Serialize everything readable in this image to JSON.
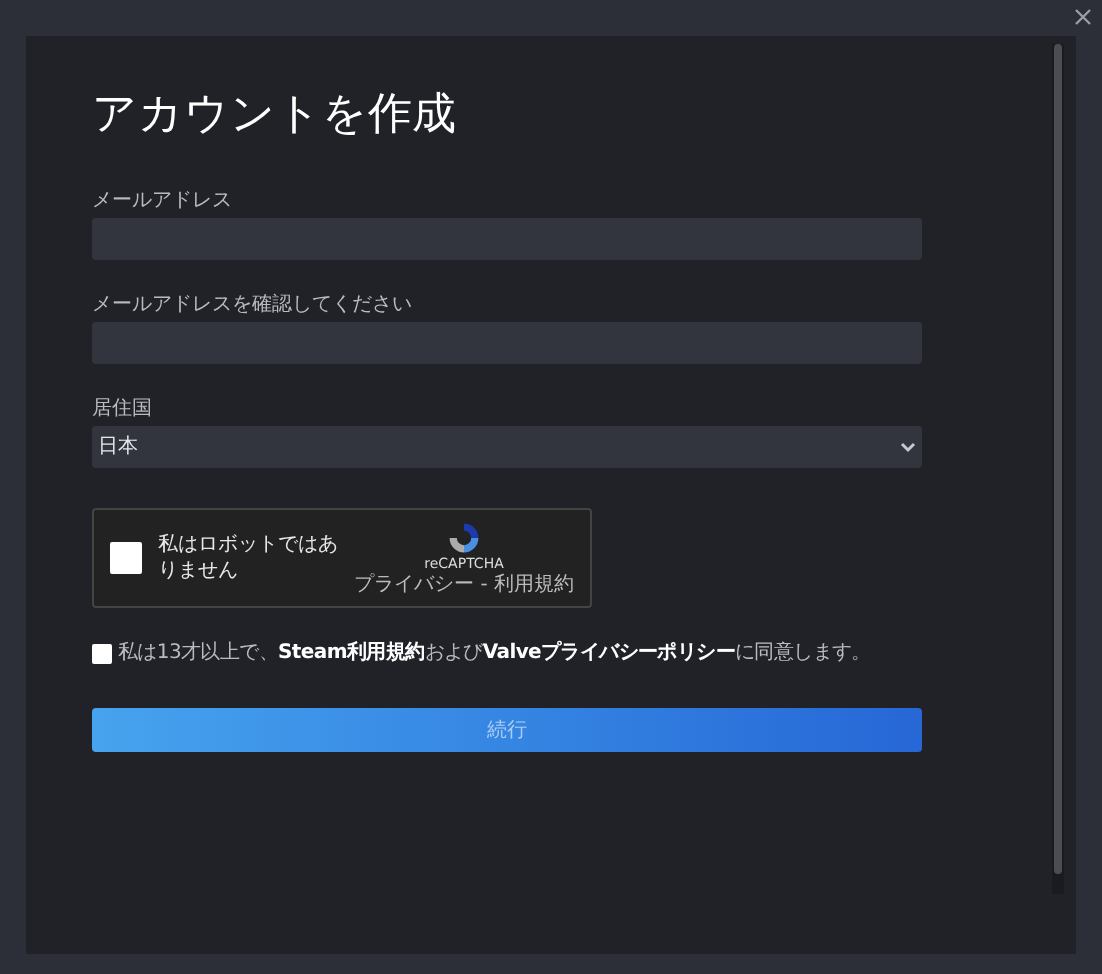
{
  "title": "アカウントを作成",
  "fields": [
    {
      "label": "メールアドレス",
      "kind": "text"
    },
    {
      "label": "メールアドレスを確認してください",
      "kind": "text"
    },
    {
      "label": "居住国",
      "kind": "select",
      "value": "日本"
    }
  ],
  "captcha": {
    "checked": false,
    "label": "私はロボットではありません",
    "brand": "reCAPTCHA",
    "links": "プライバシー - 利用規約"
  },
  "agreement": {
    "checked": false,
    "parts": [
      {
        "kind": "text",
        "text": "私は13才以上で、"
      },
      {
        "kind": "link",
        "text": "Steam利用規約"
      },
      {
        "kind": "text",
        "text": "および"
      },
      {
        "kind": "link",
        "text": "Valveプライバシーポリシー"
      },
      {
        "kind": "text",
        "text": "に同意します。"
      }
    ]
  },
  "continue_button": "続行"
}
